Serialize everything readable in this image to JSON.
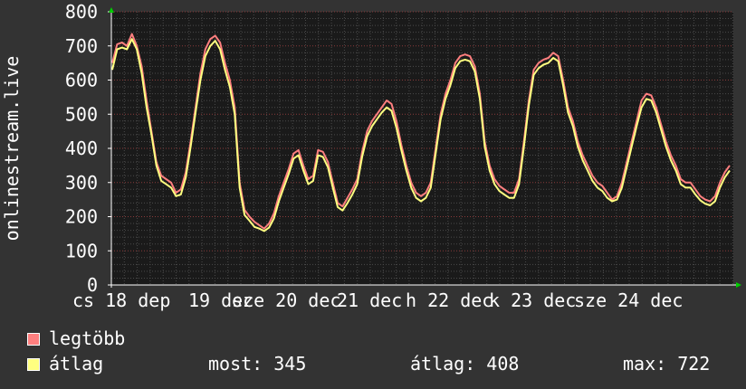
{
  "chart_data": {
    "type": "line",
    "title": "",
    "ylabel": "onlinestream.live",
    "ylim": [
      0,
      800
    ],
    "yticks": [
      0,
      100,
      200,
      300,
      400,
      500,
      600,
      700,
      800
    ],
    "xtick_labels": [
      "cs 18 dep",
      "19 dec",
      "sze 20 dec",
      "21 dec",
      "h 22 dec",
      "k 23 dec",
      "sze 24 dec"
    ],
    "grid": true,
    "legend_placement": "bottom-left",
    "series": [
      {
        "name": "legtöbb",
        "color": "#ff7f7f",
        "values": [
          650,
          705,
          710,
          700,
          735,
          700,
          640,
          540,
          450,
          360,
          320,
          310,
          300,
          270,
          280,
          330,
          420,
          520,
          620,
          690,
          720,
          730,
          710,
          650,
          600,
          520,
          300,
          220,
          200,
          185,
          175,
          165,
          180,
          210,
          260,
          300,
          340,
          385,
          395,
          350,
          310,
          320,
          395,
          390,
          360,
          300,
          240,
          230,
          255,
          280,
          310,
          390,
          450,
          480,
          500,
          520,
          540,
          530,
          480,
          410,
          350,
          300,
          270,
          260,
          270,
          300,
          400,
          500,
          560,
          600,
          650,
          670,
          675,
          670,
          640,
          560,
          420,
          350,
          310,
          290,
          280,
          270,
          270,
          310,
          420,
          540,
          630,
          650,
          660,
          665,
          680,
          670,
          600,
          520,
          480,
          420,
          380,
          350,
          320,
          300,
          290,
          270,
          250,
          260,
          300,
          360,
          420,
          480,
          540,
          560,
          555,
          520,
          470,
          420,
          380,
          350,
          310,
          300,
          300,
          280,
          260,
          250,
          245,
          260,
          300,
          330,
          350
        ]
      },
      {
        "name": "átlag",
        "color": "#ffff80",
        "values": [
          630,
          690,
          695,
          690,
          720,
          690,
          620,
          520,
          440,
          350,
          305,
          295,
          285,
          260,
          265,
          315,
          405,
          505,
          600,
          670,
          700,
          715,
          690,
          630,
          580,
          500,
          285,
          205,
          188,
          170,
          165,
          158,
          168,
          195,
          245,
          285,
          325,
          370,
          380,
          335,
          295,
          305,
          380,
          375,
          345,
          285,
          228,
          218,
          240,
          265,
          295,
          375,
          435,
          465,
          485,
          505,
          520,
          510,
          460,
          395,
          335,
          285,
          255,
          245,
          255,
          285,
          385,
          485,
          545,
          585,
          635,
          655,
          660,
          655,
          625,
          545,
          405,
          335,
          295,
          275,
          265,
          255,
          255,
          295,
          405,
          525,
          615,
          635,
          645,
          650,
          665,
          655,
          585,
          505,
          465,
          405,
          365,
          335,
          305,
          285,
          275,
          255,
          245,
          250,
          285,
          345,
          405,
          465,
          520,
          545,
          540,
          505,
          455,
          405,
          365,
          335,
          295,
          285,
          285,
          265,
          248,
          238,
          233,
          245,
          285,
          315,
          335
        ]
      }
    ]
  },
  "legend": [
    {
      "label": "legtöbb",
      "color": "#ff7f7f"
    },
    {
      "label": "átlag",
      "color": "#ffff80"
    }
  ],
  "stats": {
    "most": "most: 345",
    "atlag": "átlag: 408",
    "max": "max: 722"
  }
}
